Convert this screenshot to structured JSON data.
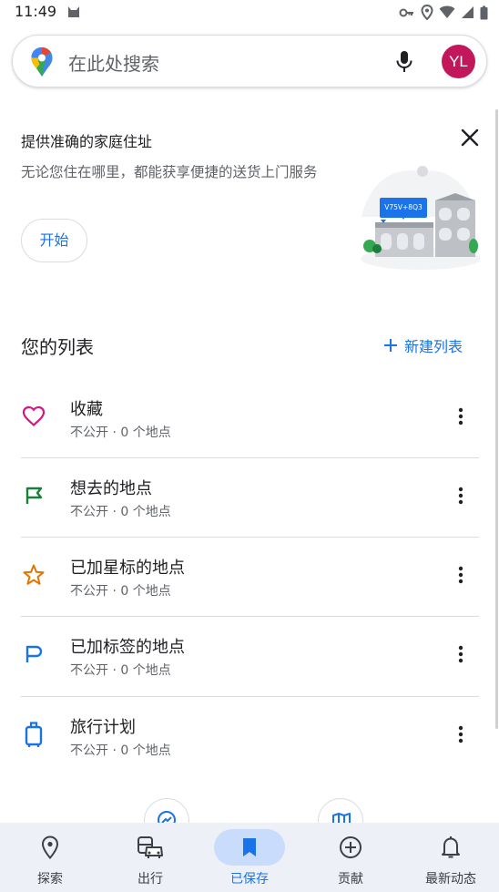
{
  "status_bar": {
    "time": "11:49"
  },
  "search": {
    "placeholder": "在此处搜索",
    "avatar_initials": "YL",
    "avatar_color": "#c2185b"
  },
  "promo": {
    "title": "提供准确的家庭住址",
    "body": "无论您住在哪里，都能获享便捷的送货上门服务",
    "start_label": "开始",
    "plus_code": "V75V+8Q3"
  },
  "lists": {
    "title": "您的列表",
    "new_list_label": "新建列表",
    "items": [
      {
        "title": "收藏",
        "meta": "不公开 · 0 个地点",
        "icon": "heart-icon",
        "color": "#d01884"
      },
      {
        "title": "想去的地点",
        "meta": "不公开 · 0 个地点",
        "icon": "flag-icon",
        "color": "#188038"
      },
      {
        "title": "已加星标的地点",
        "meta": "不公开 · 0 个地点",
        "icon": "star-icon",
        "color": "#e37400"
      },
      {
        "title": "已加标签的地点",
        "meta": "不公开 · 0 个地点",
        "icon": "label-flag-icon",
        "color": "#1a73e8"
      },
      {
        "title": "旅行计划",
        "meta": "不公开 · 0 个地点",
        "icon": "suitcase-icon",
        "color": "#1a73e8"
      }
    ]
  },
  "bottom_nav": {
    "items": [
      {
        "label": "探索",
        "icon": "explore-pin-icon"
      },
      {
        "label": "出行",
        "icon": "commute-icon"
      },
      {
        "label": "已保存",
        "icon": "bookmark-icon",
        "active": true
      },
      {
        "label": "贡献",
        "icon": "add-circle-icon"
      },
      {
        "label": "最新动态",
        "icon": "bell-icon"
      }
    ]
  },
  "colors": {
    "accent": "#1a73e8",
    "nav_background": "#edf1f7",
    "active_pill": "#c9dcfb"
  }
}
